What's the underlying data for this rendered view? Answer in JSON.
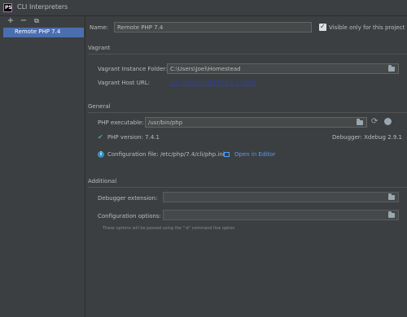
{
  "window": {
    "title": "CLI Interpreters",
    "logo_text": "PS"
  },
  "toolbar": {
    "add": "+",
    "remove": "−",
    "copy": "⧉"
  },
  "interpreters": [
    {
      "label": "Remote PHP 7.4"
    }
  ],
  "form": {
    "name_label": "Name:",
    "name_value": "Remote PHP 7.4",
    "visible_label": "Visible only for this project",
    "visible_checked": true
  },
  "vagrant": {
    "section": "Vagrant",
    "folder_label": "Vagrant Instance Folder:",
    "folder_value": "C:\\Users\\Joel\\Homestead",
    "host_label": "Vagrant Host URL:",
    "host_value": "ssh://vagrant@127.0.0.1:2222"
  },
  "general": {
    "section": "General",
    "exe_label": "PHP executable:",
    "exe_value": "/usr/bin/php",
    "version_text": "PHP version: 7.4.1",
    "debugger_text": "Debugger: Xdebug 2.9.1",
    "config_text": "Configuration file: /etc/php/7.4/cli/php.ini",
    "open_editor": "Open in Editor"
  },
  "additional": {
    "section": "Additional",
    "debugger_ext_label": "Debugger extension:",
    "config_options_label": "Configuration options:",
    "hint": "These options will be passed using the \"-d\" command line option"
  }
}
